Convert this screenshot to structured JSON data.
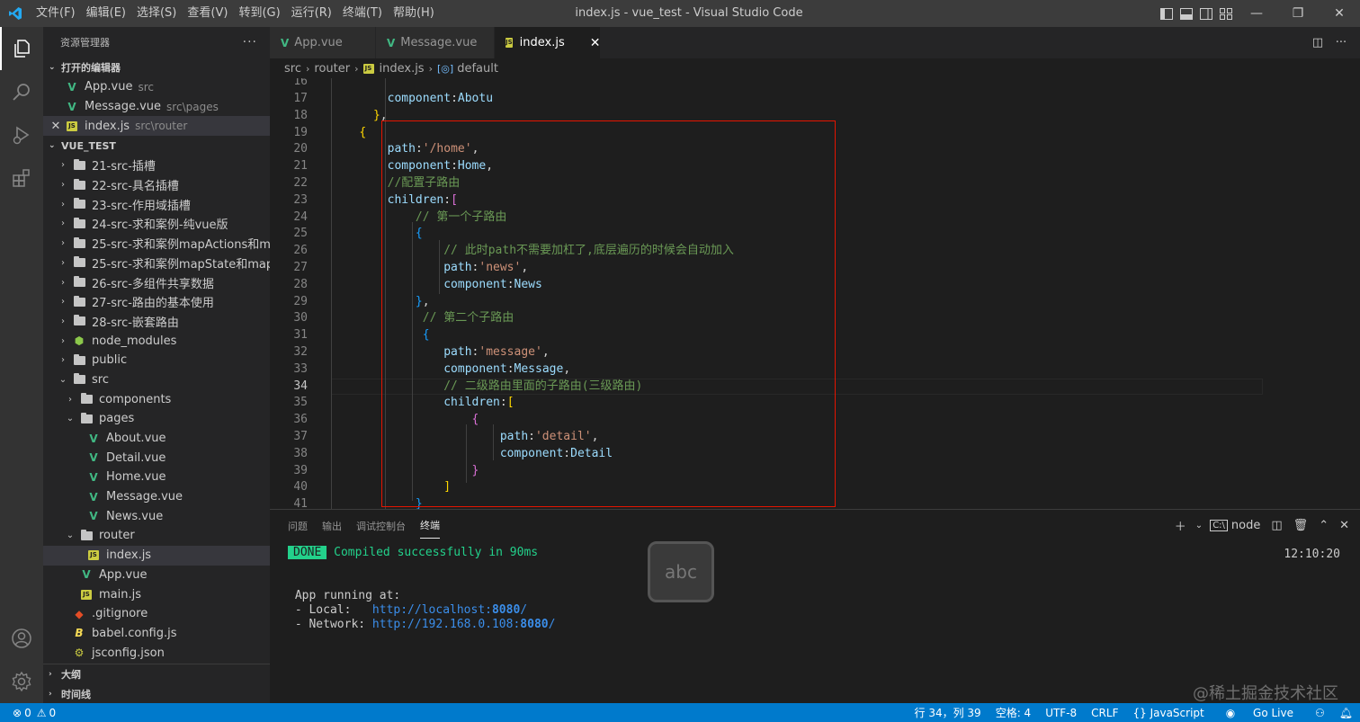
{
  "titlebar": {
    "menu": [
      "文件(F)",
      "编辑(E)",
      "选择(S)",
      "查看(V)",
      "转到(G)",
      "运行(R)",
      "终端(T)",
      "帮助(H)"
    ],
    "title": "index.js - vue_test - Visual Studio Code"
  },
  "sidebar": {
    "header": "资源管理器",
    "open_editors_label": "打开的编辑器",
    "open_editors": [
      {
        "name": "App.vue",
        "desc": "src",
        "icon": "vue"
      },
      {
        "name": "Message.vue",
        "desc": "src\\pages",
        "icon": "vue"
      },
      {
        "name": "index.js",
        "desc": "src\\router",
        "icon": "js"
      }
    ],
    "project_label": "VUE_TEST",
    "tree": [
      {
        "name": "21-src-插槽",
        "icon": "folder",
        "depth": 0,
        "twist": "›"
      },
      {
        "name": "22-src-具名插槽",
        "icon": "folder",
        "depth": 0,
        "twist": "›"
      },
      {
        "name": "23-src-作用域插槽",
        "icon": "folder",
        "depth": 0,
        "twist": "›"
      },
      {
        "name": "24-src-求和案例-纯vue版",
        "icon": "folder",
        "depth": 0,
        "twist": "›"
      },
      {
        "name": "25-src-求和案例mapActions和ma...",
        "icon": "folder",
        "depth": 0,
        "twist": "›"
      },
      {
        "name": "25-src-求和案例mapState和map...",
        "icon": "folder",
        "depth": 0,
        "twist": "›"
      },
      {
        "name": "26-src-多组件共享数据",
        "icon": "folder",
        "depth": 0,
        "twist": "›"
      },
      {
        "name": "27-src-路由的基本使用",
        "icon": "folder",
        "depth": 0,
        "twist": "›"
      },
      {
        "name": "28-src-嵌套路由",
        "icon": "folder",
        "depth": 0,
        "twist": "›"
      },
      {
        "name": "node_modules",
        "icon": "node",
        "depth": 0,
        "twist": "›"
      },
      {
        "name": "public",
        "icon": "folder",
        "depth": 0,
        "twist": "›"
      },
      {
        "name": "src",
        "icon": "folder",
        "depth": 0,
        "twist": "⌄"
      },
      {
        "name": "components",
        "icon": "folder",
        "depth": 1,
        "twist": "›"
      },
      {
        "name": "pages",
        "icon": "folder",
        "depth": 1,
        "twist": "⌄"
      },
      {
        "name": "About.vue",
        "icon": "vue",
        "depth": 2,
        "twist": ""
      },
      {
        "name": "Detail.vue",
        "icon": "vue",
        "depth": 2,
        "twist": ""
      },
      {
        "name": "Home.vue",
        "icon": "vue",
        "depth": 2,
        "twist": ""
      },
      {
        "name": "Message.vue",
        "icon": "vue",
        "depth": 2,
        "twist": ""
      },
      {
        "name": "News.vue",
        "icon": "vue",
        "depth": 2,
        "twist": ""
      },
      {
        "name": "router",
        "icon": "folder",
        "depth": 1,
        "twist": "⌄"
      },
      {
        "name": "index.js",
        "icon": "js",
        "depth": 2,
        "twist": "",
        "selected": true
      },
      {
        "name": "App.vue",
        "icon": "vue",
        "depth": 1,
        "twist": ""
      },
      {
        "name": "main.js",
        "icon": "js",
        "depth": 1,
        "twist": ""
      },
      {
        "name": ".gitignore",
        "icon": "git",
        "depth": 0,
        "twist": ""
      },
      {
        "name": "babel.config.js",
        "icon": "babel",
        "depth": 0,
        "twist": ""
      },
      {
        "name": "jsconfig.json",
        "icon": "json",
        "depth": 0,
        "twist": ""
      }
    ],
    "outline_label": "大纲",
    "timeline_label": "时间线"
  },
  "tabs": [
    {
      "label": "App.vue",
      "icon": "vue",
      "active": false
    },
    {
      "label": "Message.vue",
      "icon": "vue",
      "active": false
    },
    {
      "label": "index.js",
      "icon": "js",
      "active": true
    }
  ],
  "breadcrumb": [
    "src",
    "router",
    "index.js",
    "default"
  ],
  "editor": {
    "current_line": 34,
    "lines": [
      {
        "n": 17,
        "tokens": [
          [
            "d",
            "        "
          ],
          [
            "p",
            "component"
          ],
          [
            "d",
            ":"
          ],
          [
            "p",
            "Abotu"
          ]
        ]
      },
      {
        "n": 18,
        "tokens": [
          [
            "d",
            "      "
          ],
          [
            "y",
            "}"
          ],
          [
            "d",
            ","
          ]
        ]
      },
      {
        "n": 19,
        "tokens": [
          [
            "d",
            "    "
          ],
          [
            "y",
            "{"
          ]
        ]
      },
      {
        "n": 20,
        "tokens": [
          [
            "d",
            "        "
          ],
          [
            "p",
            "path"
          ],
          [
            "d",
            ":"
          ],
          [
            "s",
            "'/home'"
          ],
          [
            "d",
            ","
          ]
        ]
      },
      {
        "n": 21,
        "tokens": [
          [
            "d",
            "        "
          ],
          [
            "p",
            "component"
          ],
          [
            "d",
            ":"
          ],
          [
            "p",
            "Home"
          ],
          [
            "d",
            ","
          ]
        ]
      },
      {
        "n": 22,
        "tokens": [
          [
            "d",
            "        "
          ],
          [
            "c",
            "//配置子路由"
          ]
        ]
      },
      {
        "n": 23,
        "tokens": [
          [
            "d",
            "        "
          ],
          [
            "p",
            "children"
          ],
          [
            "d",
            ":"
          ],
          [
            "m",
            "["
          ]
        ]
      },
      {
        "n": 24,
        "tokens": [
          [
            "d",
            "            "
          ],
          [
            "c",
            "// 第一个子路由"
          ]
        ]
      },
      {
        "n": 25,
        "tokens": [
          [
            "d",
            "            "
          ],
          [
            "b",
            "{"
          ]
        ]
      },
      {
        "n": 26,
        "tokens": [
          [
            "d",
            "                "
          ],
          [
            "c",
            "// 此时path不需要加杠了,底层遍历的时候会自动加入"
          ]
        ]
      },
      {
        "n": 27,
        "tokens": [
          [
            "d",
            "                "
          ],
          [
            "p",
            "path"
          ],
          [
            "d",
            ":"
          ],
          [
            "s",
            "'news'"
          ],
          [
            "d",
            ","
          ]
        ]
      },
      {
        "n": 28,
        "tokens": [
          [
            "d",
            "                "
          ],
          [
            "p",
            "component"
          ],
          [
            "d",
            ":"
          ],
          [
            "p",
            "News"
          ]
        ]
      },
      {
        "n": 29,
        "tokens": [
          [
            "d",
            "            "
          ],
          [
            "b",
            "}"
          ],
          [
            "d",
            ","
          ]
        ]
      },
      {
        "n": 30,
        "tokens": [
          [
            "d",
            "             "
          ],
          [
            "c",
            "// 第二个子路由"
          ]
        ]
      },
      {
        "n": 31,
        "tokens": [
          [
            "d",
            "             "
          ],
          [
            "b",
            "{"
          ]
        ]
      },
      {
        "n": 32,
        "tokens": [
          [
            "d",
            "                "
          ],
          [
            "p",
            "path"
          ],
          [
            "d",
            ":"
          ],
          [
            "s",
            "'message'"
          ],
          [
            "d",
            ","
          ]
        ]
      },
      {
        "n": 33,
        "tokens": [
          [
            "d",
            "                "
          ],
          [
            "p",
            "component"
          ],
          [
            "d",
            ":"
          ],
          [
            "p",
            "Message"
          ],
          [
            "d",
            ","
          ]
        ]
      },
      {
        "n": 34,
        "tokens": [
          [
            "d",
            "                "
          ],
          [
            "c",
            "// 二级路由里面的子路由(三级路由)"
          ]
        ]
      },
      {
        "n": 35,
        "tokens": [
          [
            "d",
            "                "
          ],
          [
            "p",
            "children"
          ],
          [
            "d",
            ":"
          ],
          [
            "y",
            "["
          ]
        ]
      },
      {
        "n": 36,
        "tokens": [
          [
            "d",
            "                    "
          ],
          [
            "m",
            "{"
          ]
        ]
      },
      {
        "n": 37,
        "tokens": [
          [
            "d",
            "                        "
          ],
          [
            "p",
            "path"
          ],
          [
            "d",
            ":"
          ],
          [
            "s",
            "'detail'"
          ],
          [
            "d",
            ","
          ]
        ]
      },
      {
        "n": 38,
        "tokens": [
          [
            "d",
            "                        "
          ],
          [
            "p",
            "component"
          ],
          [
            "d",
            ":"
          ],
          [
            "p",
            "Detail"
          ]
        ]
      },
      {
        "n": 39,
        "tokens": [
          [
            "d",
            "                    "
          ],
          [
            "m",
            "}"
          ]
        ]
      },
      {
        "n": 40,
        "tokens": [
          [
            "d",
            "                "
          ],
          [
            "y",
            "]"
          ]
        ]
      },
      {
        "n": 41,
        "tokens": [
          [
            "d",
            "            "
          ],
          [
            "b",
            "}"
          ]
        ]
      }
    ]
  },
  "panel": {
    "tabs": [
      "问题",
      "输出",
      "调试控制台",
      "终端"
    ],
    "active_tab": "终端",
    "terminal_name": "node",
    "done_badge": "DONE",
    "compiled": "Compiled successfully in 90ms",
    "time": "12:10:20",
    "running": "App running at:",
    "local_label": "- Local:   ",
    "local_url_base": "http://localhost:",
    "local_port": "8080",
    "local_url_end": "/",
    "network_label": "- Network: ",
    "network_url_base": "http://192.168.0.108:",
    "network_port": "8080",
    "network_url_end": "/",
    "ime_label": "abc"
  },
  "statusbar": {
    "errors": "0",
    "warnings": "0",
    "position": "行 34，列 39",
    "spaces": "空格: 4",
    "encoding": "UTF-8",
    "eol": "CRLF",
    "language": "{} JavaScript",
    "golive": "Go Live"
  },
  "watermark": "@稀土掘金技术社区",
  "colors": {
    "accent": "#007acc",
    "highlight_box": "#e51400",
    "vue": "#41b883",
    "js": "#cbcb41"
  }
}
